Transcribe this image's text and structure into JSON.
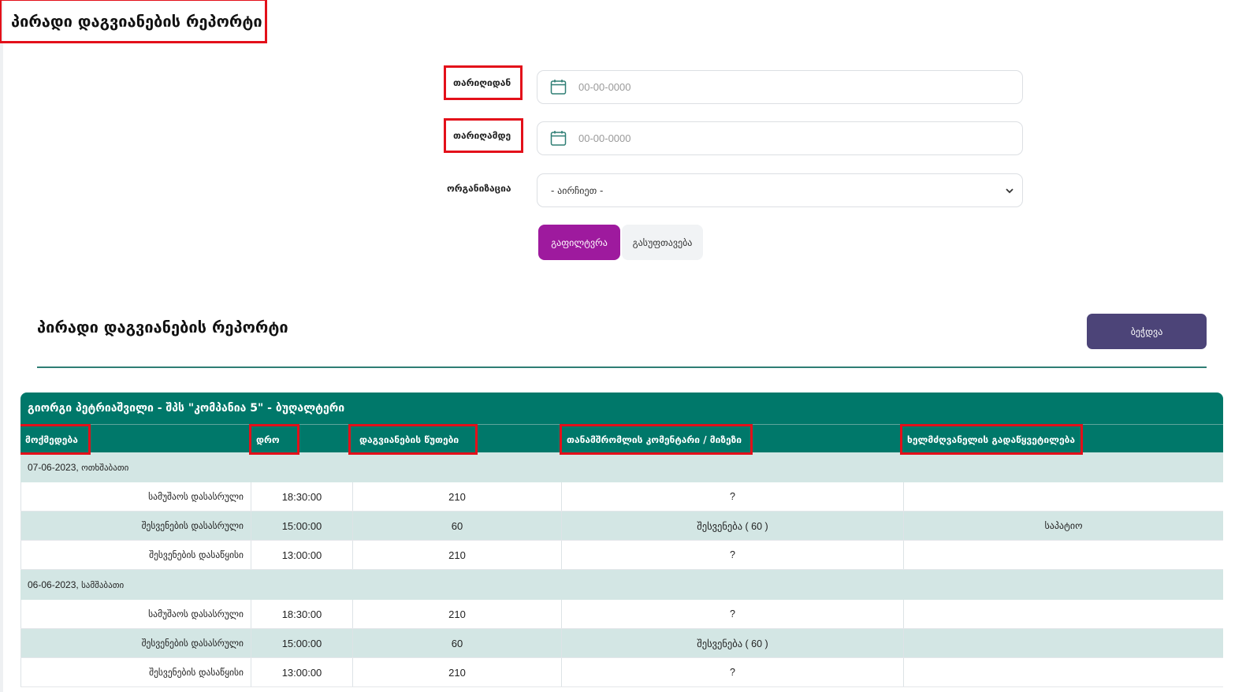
{
  "page": {
    "title": "პირადი დაგვიანების რეპორტი"
  },
  "filters": {
    "from_label": "თარიღიდან",
    "from_placeholder": "00-00-0000",
    "to_label": "თარიღამდე",
    "to_placeholder": "00-00-0000",
    "org_label": "ორგანიზაცია",
    "org_selected": "- აირჩიეთ -",
    "filter_button": "გაფილტვრა",
    "clear_button": "გასუფთავება"
  },
  "report": {
    "title": "პირადი დაგვიანების რეპორტი",
    "print_button": "ბეჭდვა",
    "group_header": "გიორგი პეტრიაშვილი - შპს \"კომპანია 5\" - ბუღალტერი",
    "columns": {
      "action": "მოქმედება",
      "time": "დრო",
      "minutes": "დაგვიანების წუთები",
      "comment": "თანამშრომლის კომენტარი / მიზეზი",
      "decision": "ხელმძღვანელის გადაწყვეტილება"
    },
    "days": [
      {
        "date": "07-06-2023,",
        "weekday": "ოთხშაბათი",
        "rows": [
          {
            "action": "სამუშაოს დასასრული",
            "time": "18:30:00",
            "minutes": "210",
            "comment": "?",
            "decision": ""
          },
          {
            "action": "შესვენების დასასრული",
            "time": "15:00:00",
            "minutes": "60",
            "comment": "შესვენება ( 60 )",
            "decision": "საპატიო"
          },
          {
            "action": "შესვენების დასაწყისი",
            "time": "13:00:00",
            "minutes": "210",
            "comment": "?",
            "decision": ""
          }
        ]
      },
      {
        "date": "06-06-2023,",
        "weekday": "სამშაბათი",
        "rows": [
          {
            "action": "სამუშაოს დასასრული",
            "time": "18:30:00",
            "minutes": "210",
            "comment": "?",
            "decision": ""
          },
          {
            "action": "შესვენების დასასრული",
            "time": "15:00:00",
            "minutes": "60",
            "comment": "შესვენება ( 60 )",
            "decision": ""
          },
          {
            "action": "შესვენების დასაწყისი",
            "time": "13:00:00",
            "minutes": "210",
            "comment": "?",
            "decision": ""
          }
        ]
      }
    ]
  },
  "colors": {
    "teal": "#00786a",
    "teal_light": "#d3e6e4",
    "filter_purple": "#9e1a9e",
    "print_indigo": "#4c4478",
    "highlight_red": "#e3101a"
  },
  "icons": {
    "calendar": "calendar-icon",
    "select_arrow": "chevron-down-icon"
  }
}
